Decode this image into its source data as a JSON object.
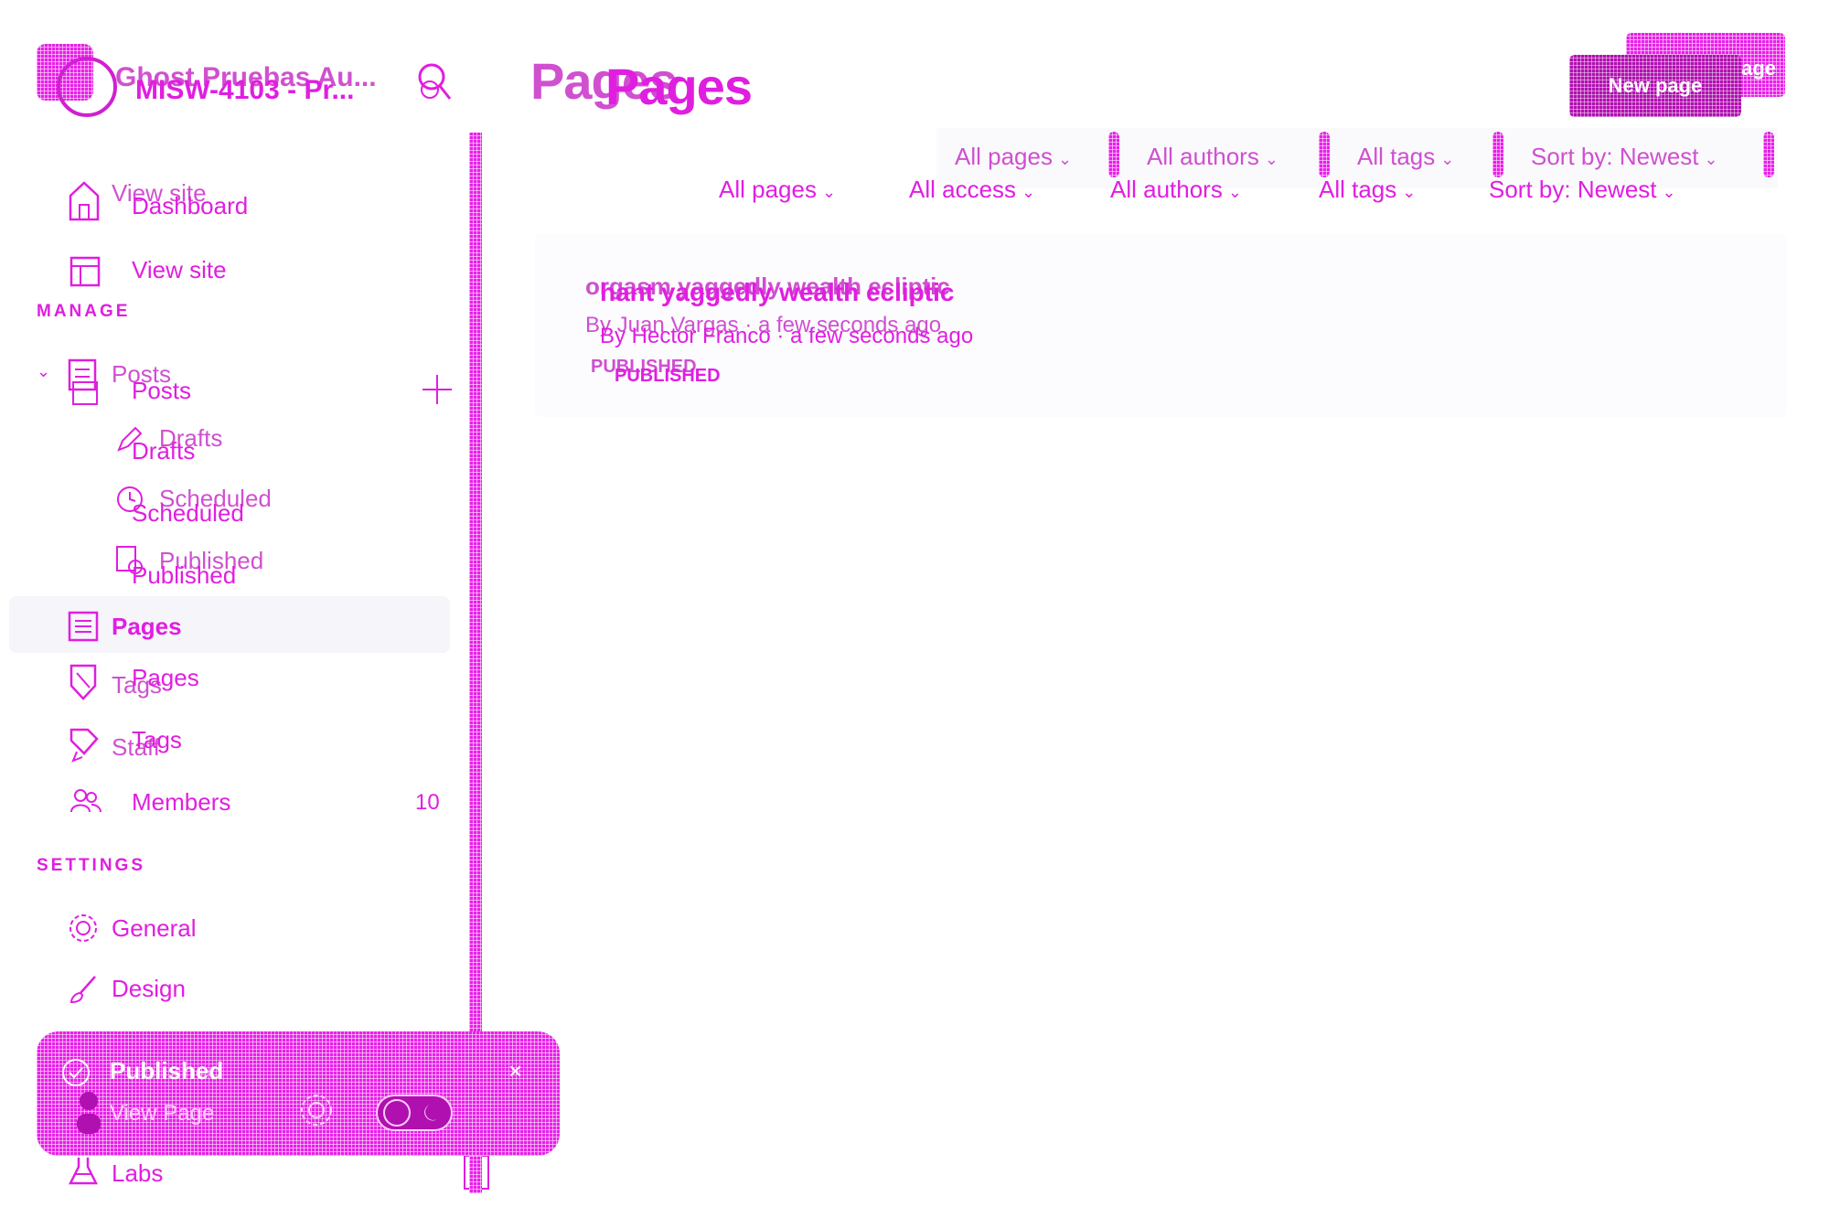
{
  "sidebar": {
    "site_title_primary": "Ghost Pruebas Au...",
    "site_title_secondary": "MISW-4103 - Pr...",
    "items": {
      "view_site_a": "View site",
      "dashboard": "Dashboard",
      "view_site_b": "View site",
      "posts_a": "Posts",
      "posts_b": "Posts",
      "drafts_a": "Drafts",
      "drafts_b": "Drafts",
      "scheduled_a": "Scheduled",
      "scheduled_b": "Scheduled",
      "published_a": "Published",
      "published_b": "Published",
      "pages_a": "Pages",
      "pages_b": "Pages",
      "tags_a": "Tags",
      "tags_b": "Tags",
      "staff": "Staff",
      "members": "Members",
      "members_count": "10",
      "general": "General",
      "design": "Design",
      "labs": "Labs"
    },
    "manage_label": "MANAGE",
    "settings_label": "SETTINGS"
  },
  "header": {
    "title_a": "Pages",
    "title_b": "Pages",
    "new_page_button_a": "New page",
    "new_page_button_b": "New page"
  },
  "filters_row1": [
    "All pages",
    "All authors",
    "All tags",
    "Sort by: Newest"
  ],
  "filters_row2": [
    "All pages",
    "All access",
    "All authors",
    "All tags",
    "Sort by: Newest"
  ],
  "page_list": {
    "title_a": "orgasm yaggedly wealth ecliptic",
    "title_b": "hant yaggedly wealth ecliptic",
    "meta_a": "By Juan Vargas · a few seconds ago",
    "meta_b": "By Hector Franco · a few seconds ago",
    "status_a": "PUBLISHED",
    "status_b": "PUBLISHED"
  },
  "toast": {
    "title": "Published",
    "link": "View Page",
    "close": "×"
  },
  "colors": {
    "accent": "#e01ee0",
    "accent_dark": "#b010b0",
    "background": "#ffffff"
  }
}
